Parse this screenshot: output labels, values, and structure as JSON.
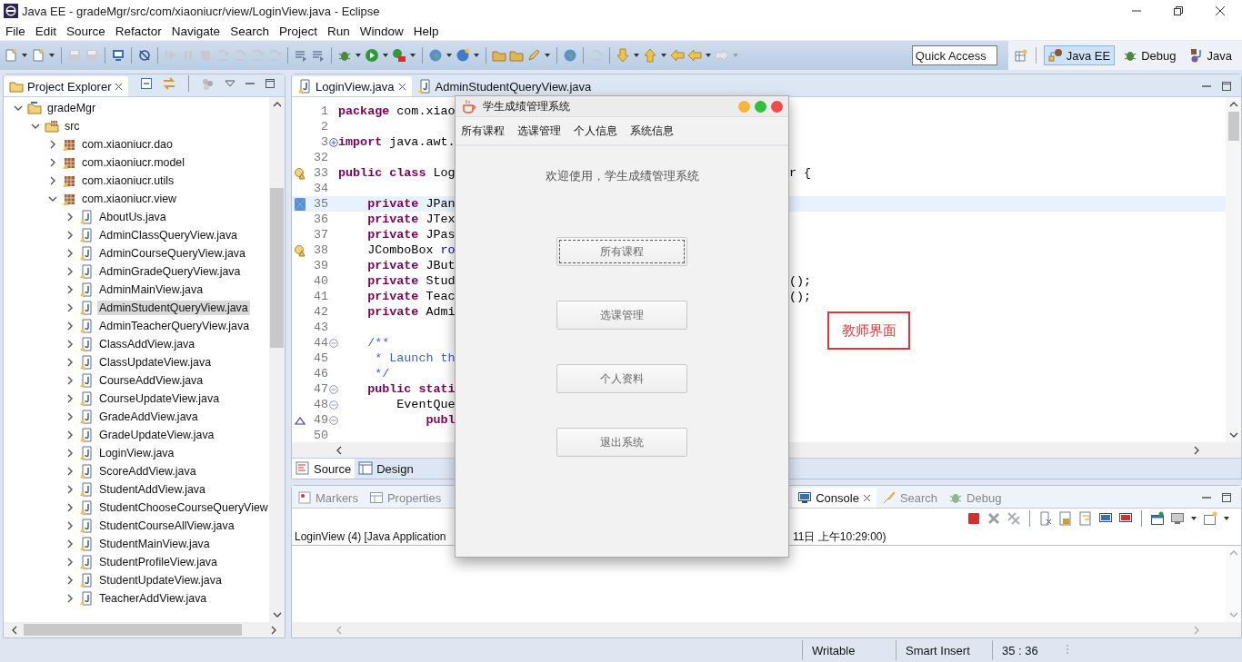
{
  "window": {
    "title": "Java EE - gradeMgr/src/com/xiaoniucr/view/LoginView.java - Eclipse"
  },
  "menu_bar": [
    "File",
    "Edit",
    "Source",
    "Refactor",
    "Navigate",
    "Search",
    "Project",
    "Run",
    "Window",
    "Help"
  ],
  "quick_access": {
    "placeholder": "Quick Access"
  },
  "perspectives": [
    {
      "label": "Java EE",
      "selected": true
    },
    {
      "label": "Debug",
      "selected": false
    },
    {
      "label": "Java",
      "selected": false
    }
  ],
  "project_explorer": {
    "title": "Project Explorer",
    "tree": [
      {
        "label": "gradeMgr",
        "kind": "project",
        "expanded": true,
        "selected": false,
        "children": [
          {
            "label": "src",
            "kind": "source",
            "expanded": true,
            "selected": false,
            "children": [
              {
                "label": "com.xiaoniucr.dao",
                "kind": "package",
                "expanded": false,
                "selected": false
              },
              {
                "label": "com.xiaoniucr.model",
                "kind": "package",
                "expanded": false,
                "selected": false
              },
              {
                "label": "com.xiaoniucr.utils",
                "kind": "package",
                "expanded": false,
                "selected": false
              },
              {
                "label": "com.xiaoniucr.view",
                "kind": "package",
                "expanded": true,
                "selected": false,
                "children": [
                  {
                    "label": "AboutUs.java",
                    "kind": "file",
                    "expanded": false,
                    "selected": false
                  },
                  {
                    "label": "AdminClassQueryView.java",
                    "kind": "file",
                    "expanded": false,
                    "selected": false
                  },
                  {
                    "label": "AdminCourseQueryView.java",
                    "kind": "file",
                    "expanded": false,
                    "selected": false
                  },
                  {
                    "label": "AdminGradeQueryView.java",
                    "kind": "file",
                    "expanded": false,
                    "selected": false
                  },
                  {
                    "label": "AdminMainView.java",
                    "kind": "file",
                    "expanded": false,
                    "selected": false
                  },
                  {
                    "label": "AdminStudentQueryView.java",
                    "kind": "file",
                    "expanded": false,
                    "selected": true
                  },
                  {
                    "label": "AdminTeacherQueryView.java",
                    "kind": "file",
                    "expanded": false,
                    "selected": false
                  },
                  {
                    "label": "ClassAddView.java",
                    "kind": "file",
                    "expanded": false,
                    "selected": false
                  },
                  {
                    "label": "ClassUpdateView.java",
                    "kind": "file",
                    "expanded": false,
                    "selected": false
                  },
                  {
                    "label": "CourseAddView.java",
                    "kind": "file",
                    "expanded": false,
                    "selected": false
                  },
                  {
                    "label": "CourseUpdateView.java",
                    "kind": "file",
                    "expanded": false,
                    "selected": false
                  },
                  {
                    "label": "GradeAddView.java",
                    "kind": "file",
                    "expanded": false,
                    "selected": false
                  },
                  {
                    "label": "GradeUpdateView.java",
                    "kind": "file",
                    "expanded": false,
                    "selected": false
                  },
                  {
                    "label": "LoginView.java",
                    "kind": "file",
                    "expanded": false,
                    "selected": false
                  },
                  {
                    "label": "ScoreAddView.java",
                    "kind": "file",
                    "expanded": false,
                    "selected": false
                  },
                  {
                    "label": "StudentAddView.java",
                    "kind": "file",
                    "expanded": false,
                    "selected": false
                  },
                  {
                    "label": "StudentChooseCourseQueryView",
                    "kind": "file",
                    "expanded": false,
                    "selected": false
                  },
                  {
                    "label": "StudentCourseAllView.java",
                    "kind": "file",
                    "expanded": false,
                    "selected": false
                  },
                  {
                    "label": "StudentMainView.java",
                    "kind": "file",
                    "expanded": false,
                    "selected": false
                  },
                  {
                    "label": "StudentProfileView.java",
                    "kind": "file",
                    "expanded": false,
                    "selected": false
                  },
                  {
                    "label": "StudentUpdateView.java",
                    "kind": "file",
                    "expanded": false,
                    "selected": false
                  },
                  {
                    "label": "TeacherAddView.java",
                    "kind": "file",
                    "expanded": false,
                    "selected": false
                  }
                ]
              }
            ]
          }
        ]
      }
    ]
  },
  "editor": {
    "tabs": [
      {
        "label": "LoginView.java",
        "selected": true
      },
      {
        "label": "AdminStudentQueryView.java",
        "selected": false
      }
    ],
    "lines": [
      {
        "number": "1",
        "code": [
          {
            "kind": "kw",
            "text": "package"
          },
          {
            "kind": "plain",
            "text": " com.xiao"
          }
        ]
      },
      {
        "number": "2"
      },
      {
        "number": "3",
        "folded": true,
        "code": [
          {
            "kind": "kw",
            "text": "import"
          },
          {
            "kind": "plain",
            "text": " java.awt."
          }
        ]
      },
      {
        "number": "32"
      },
      {
        "number": "33",
        "marker": {
          "kind": "warning"
        },
        "code": [
          {
            "kind": "kw",
            "text": "public class"
          },
          {
            "kind": "plain",
            "text": " Log"
          }
        ],
        "right": "r {"
      },
      {
        "number": "34"
      },
      {
        "number": "35",
        "marker": {
          "kind": "bookmark"
        },
        "current": true,
        "code": [
          {
            "kind": "kw",
            "text": "    private"
          },
          {
            "kind": "plain",
            "text": " JPan"
          }
        ]
      },
      {
        "number": "36",
        "current": false,
        "code": [
          {
            "kind": "kw",
            "text": "    private"
          },
          {
            "kind": "plain",
            "text": " JTex"
          }
        ]
      },
      {
        "number": "37",
        "code": [
          {
            "kind": "kw",
            "text": "    private"
          },
          {
            "kind": "plain",
            "text": " JPas"
          }
        ]
      },
      {
        "number": "38",
        "marker": {
          "kind": "warning"
        },
        "code": [
          {
            "kind": "plain",
            "text": "    JComboBox "
          },
          {
            "kind": "field",
            "text": "ro"
          }
        ]
      },
      {
        "number": "39",
        "code": [
          {
            "kind": "kw",
            "text": "    private"
          },
          {
            "kind": "plain",
            "text": " JBut"
          }
        ]
      },
      {
        "number": "40",
        "code": [
          {
            "kind": "kw",
            "text": "    private"
          },
          {
            "kind": "plain",
            "text": " Stud"
          }
        ],
        "right": "();"
      },
      {
        "number": "41",
        "code": [
          {
            "kind": "kw",
            "text": "    private"
          },
          {
            "kind": "plain",
            "text": " Teac"
          }
        ],
        "right": "();"
      },
      {
        "number": "42",
        "code": [
          {
            "kind": "kw",
            "text": "    private"
          },
          {
            "kind": "plain",
            "text": " Admi"
          }
        ]
      },
      {
        "number": "43"
      },
      {
        "number": "44",
        "folded": false,
        "code": [
          {
            "kind": "doc",
            "text": "    /**"
          }
        ]
      },
      {
        "number": "45",
        "code": [
          {
            "kind": "doc",
            "text": "     * Launch th"
          }
        ]
      },
      {
        "number": "46",
        "code": [
          {
            "kind": "doc",
            "text": "     */"
          }
        ]
      },
      {
        "number": "47",
        "folded": false,
        "code": [
          {
            "kind": "kw",
            "text": "    public stati"
          }
        ]
      },
      {
        "number": "48",
        "folded": false,
        "code": [
          {
            "kind": "plain",
            "text": "        EventQue"
          }
        ]
      },
      {
        "number": "49",
        "folded": false,
        "marker": {
          "kind": "override"
        },
        "code": [
          {
            "kind": "kw",
            "text": "            publ"
          }
        ]
      },
      {
        "number": "50"
      }
    ],
    "bottom_tabs": [
      {
        "label": "Source",
        "selected": true
      },
      {
        "label": "Design",
        "selected": false
      }
    ]
  },
  "console_panel": {
    "tabs": [
      {
        "label": "Markers",
        "selected": false
      },
      {
        "label": "Properties",
        "selected": false
      },
      {
        "label": "Console",
        "selected": true
      },
      {
        "label": "Search",
        "selected": false
      },
      {
        "label": "Debug",
        "selected": false
      }
    ],
    "header_left": "LoginView (4) [Java Application",
    "header_right": "11日 上午10:29:00)"
  },
  "status_bar": [
    "Writable",
    "Smart Insert",
    "35 : 36"
  ],
  "dialog": {
    "title": "学生成绩管理系统",
    "menu": [
      "所有课程",
      "选课管理",
      "个人信息",
      "系统信息"
    ],
    "welcome": "欢迎使用，学生成绩管理系统",
    "buttons": [
      {
        "label": "所有课程",
        "focused": true
      },
      {
        "label": "选课管理",
        "focused": false
      },
      {
        "label": "个人资料",
        "focused": false
      },
      {
        "label": "退出系统",
        "focused": false
      }
    ]
  },
  "annotation": {
    "text": "教师界面"
  }
}
